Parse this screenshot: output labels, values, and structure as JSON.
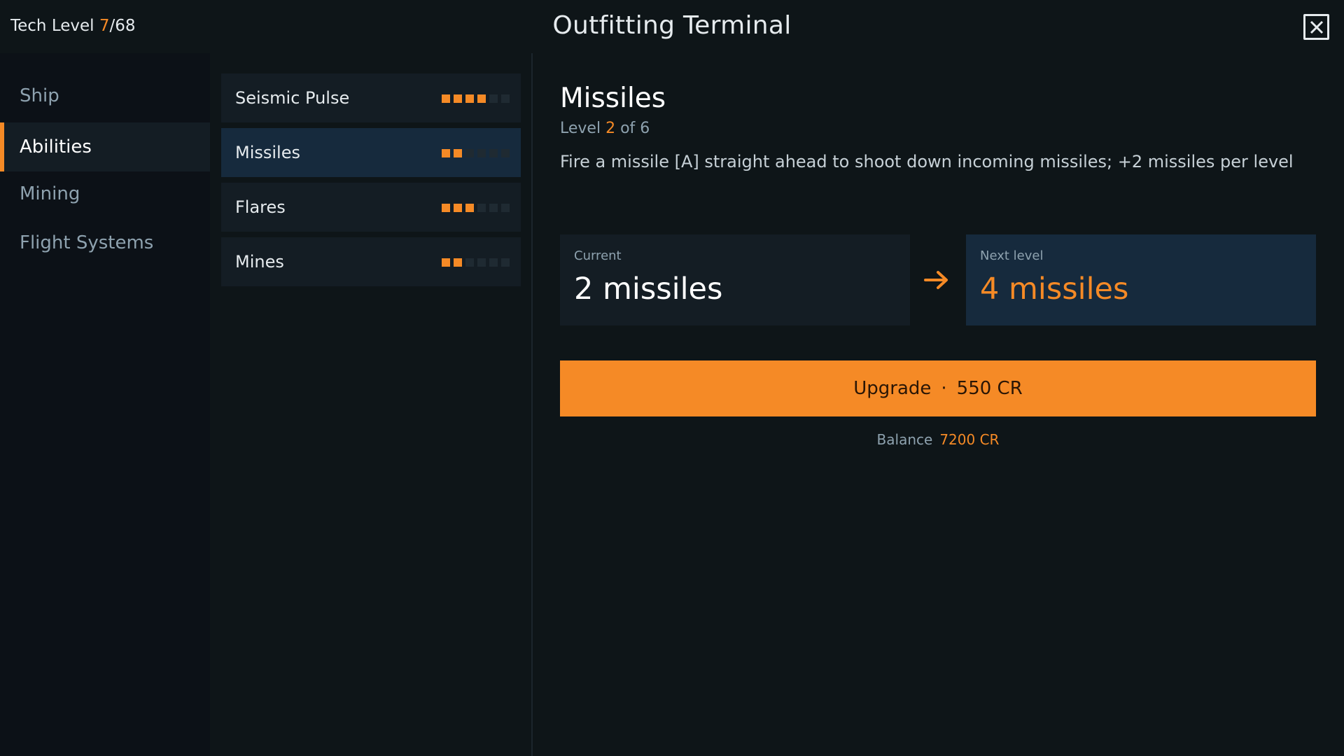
{
  "header": {
    "tech_level_label": "Tech Level",
    "tech_level_current": "7",
    "tech_level_sep": "/",
    "tech_level_max": "68",
    "title": "Outfitting Terminal",
    "close_icon": "close-icon"
  },
  "sidebar": {
    "items": [
      {
        "label": "Ship",
        "active": false
      },
      {
        "label": "Abilities",
        "active": true
      },
      {
        "label": "Mining",
        "active": false
      },
      {
        "label": "Flight Systems",
        "active": false
      }
    ]
  },
  "abilities": [
    {
      "name": "Seismic Pulse",
      "level": 4,
      "max": 6,
      "selected": false
    },
    {
      "name": "Missiles",
      "level": 2,
      "max": 6,
      "selected": true
    },
    {
      "name": "Flares",
      "level": 3,
      "max": 6,
      "selected": false
    },
    {
      "name": "Mines",
      "level": 2,
      "max": 6,
      "selected": false
    }
  ],
  "detail": {
    "title": "Missiles",
    "level_prefix": "Level",
    "level_current": "2",
    "level_of": "of 6",
    "description": "Fire a missile [A] straight ahead to shoot down incoming missiles; +2 missiles per level",
    "current_label": "Current",
    "current_value": "2 missiles",
    "next_label": "Next level",
    "next_value": "4 missiles",
    "arrow_icon": "arrow-right-icon",
    "upgrade_label": "Upgrade",
    "upgrade_dot": "·",
    "upgrade_cost": "550 CR",
    "balance_label": "Balance",
    "balance_value": "7200 CR"
  },
  "colors": {
    "accent": "#f58a26",
    "background": "#0e1518",
    "panel": "#141d24",
    "panel_selected": "#162a3d"
  }
}
